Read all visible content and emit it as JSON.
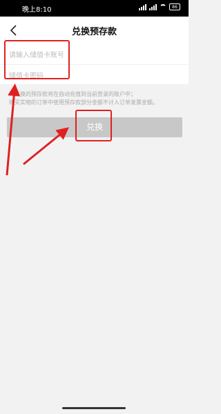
{
  "status_bar": {
    "time": "晚上8:10",
    "battery": "86"
  },
  "header": {
    "title": "兑换预存款"
  },
  "form": {
    "card_number_placeholder": "请输入储值卡账号",
    "card_password_placeholder": "储值卡密码"
  },
  "notes": [
    "所兑换的预存款将在自动充值到当前登录的账户中；",
    "购买实物的订单中使用预存款部分金额不计入订单发票金额。"
  ],
  "button": {
    "exchange_label": "兑换"
  },
  "colors": {
    "annotation_red": "#e02020",
    "button_disabled": "#c8c8c8"
  }
}
